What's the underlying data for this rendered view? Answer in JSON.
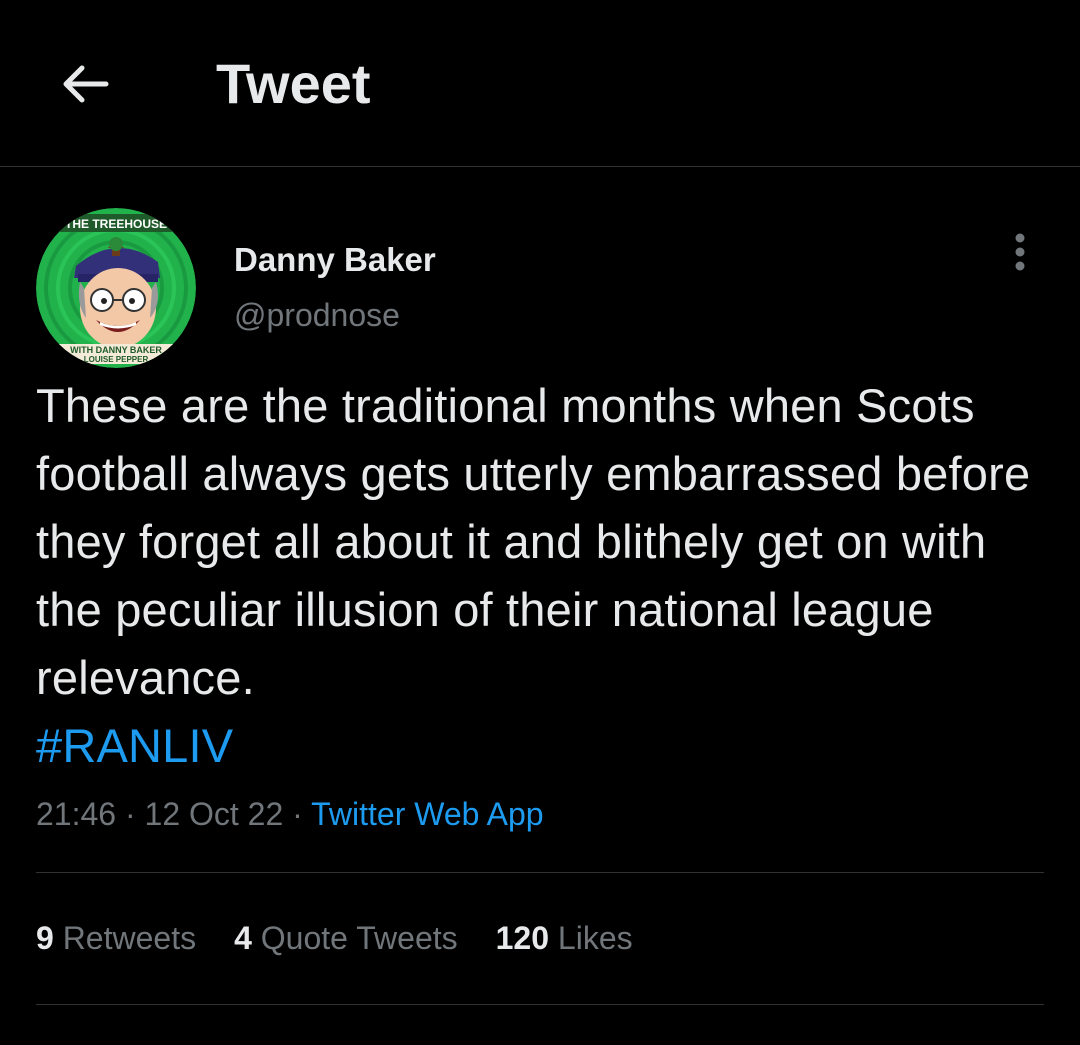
{
  "header": {
    "title": "Tweet",
    "back_icon": "arrow-left-icon"
  },
  "author": {
    "name": "Danny Baker",
    "handle": "@prodnose",
    "avatar": {
      "top_text": "THE TREEHOUSE",
      "bottom_text_1": "WITH DANNY BAKER",
      "bottom_text_2": "LOUISE PEPPER"
    }
  },
  "tweet": {
    "text": "These are the traditional months when Scots football always gets utterly embarrassed before they forget all about it and blithely get on with the peculiar illusion of their national league relevance.",
    "hashtag": "#RANLIV",
    "time": "21:46",
    "separator": "·",
    "date": "12 Oct 22",
    "source": "Twitter Web App"
  },
  "stats": {
    "retweets_count": "9",
    "retweets_label": "Retweets",
    "quotes_count": "4",
    "quotes_label": "Quote Tweets",
    "likes_count": "120",
    "likes_label": "Likes"
  },
  "colors": {
    "background": "#000000",
    "text": "#e7e9ea",
    "muted": "#71767b",
    "accent": "#1d9bf0",
    "divider": "#2f3336",
    "avatar_green": "#22b24c"
  }
}
